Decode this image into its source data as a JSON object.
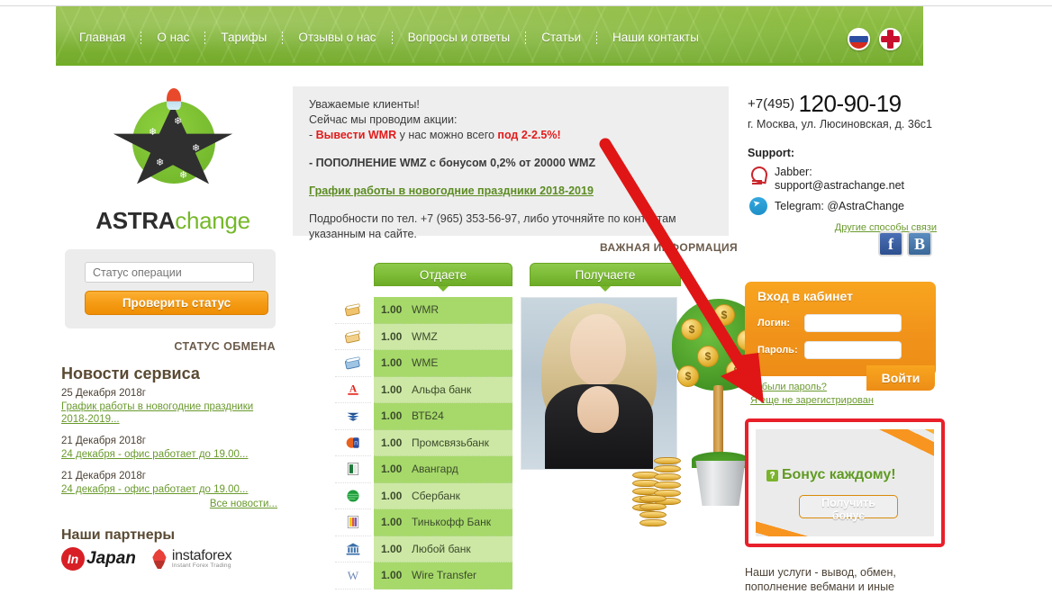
{
  "nav": {
    "items": [
      {
        "label": "Главная"
      },
      {
        "label": "О нас"
      },
      {
        "label": "Тарифы"
      },
      {
        "label": "Отзывы о нас"
      },
      {
        "label": "Вопросы и ответы"
      },
      {
        "label": "Статьи"
      },
      {
        "label": "Наши контакты"
      }
    ],
    "flags": [
      {
        "name": "russian-flag",
        "code": "RU"
      },
      {
        "name": "english-flag",
        "code": "EN"
      }
    ]
  },
  "logo": {
    "text_bold": "ASTRA",
    "text_light": "change"
  },
  "status": {
    "input_placeholder": "Статус операции",
    "input_value": "",
    "button_label": "Проверить статус",
    "caption": "СТАТУС ОБМЕНА"
  },
  "news": {
    "title": "Новости сервиса",
    "items": [
      {
        "date": "25 Декабря 2018г",
        "link": "График работы в новогодние праздники 2018-2019..."
      },
      {
        "date": "21 Декабря 2018г",
        "link": "24 декабря - офис работает до 19.00..."
      },
      {
        "date": "21 Декабря 2018г",
        "link": "24 декабря - офис работает до 19.00..."
      }
    ],
    "all_link": "Все новости..."
  },
  "partners": {
    "title": "Наши партнеры",
    "items": [
      {
        "name": "InJapan",
        "badge": "In",
        "label": "Japan"
      },
      {
        "name": "instaforex",
        "label": "instaforex",
        "sub": "Instant Forex Trading"
      }
    ]
  },
  "announcement": {
    "line1": "Уважаемые клиенты!",
    "line2": "Сейчас мы проводим акции:",
    "line3_prefix": "- ",
    "line3_red1": "Вывести WMR",
    "line3_mid": " у нас можно всего ",
    "line3_red2": "под 2-2.5%",
    "line3_suffix": "!",
    "line4": "- ПОПОЛНЕНИЕ WMZ с бонусом 0,2% от 20000 WMZ",
    "link": "График работы в новогодние праздники 2018-2019",
    "line5": "Подробности по тел. +7 (965) 353-56-97, либо уточняйте по контактам",
    "line6": "указанным на сайте.",
    "important_label": "ВАЖНАЯ ИНФОРМАЦИЯ"
  },
  "contact": {
    "phone_prefix": "+7(495)",
    "phone_main": "120-90-19",
    "address": "г. Москва, ул. Люсиновская, д. 36с1",
    "support_label": "Support:",
    "jabber_label": "Jabber:",
    "jabber_value": "support@astrachange.net",
    "telegram": "Telegram: @AstraChange",
    "other_ways": "Другие способы связи",
    "socials": [
      {
        "name": "facebook",
        "glyph": "f"
      },
      {
        "name": "vkontakte",
        "glyph": "B"
      }
    ]
  },
  "exchange": {
    "tab_give": "Отдаете",
    "tab_get": "Получаете",
    "give_rows": [
      {
        "amount": "1.00",
        "name": "WMR",
        "icon": "wmr-card-icon"
      },
      {
        "amount": "1.00",
        "name": "WMZ",
        "icon": "wmz-card-icon"
      },
      {
        "amount": "1.00",
        "name": "WME",
        "icon": "wme-card-icon"
      },
      {
        "amount": "1.00",
        "name": "Альфа банк",
        "icon": "alfabank-icon"
      },
      {
        "amount": "1.00",
        "name": "ВТБ24",
        "icon": "vtb24-icon"
      },
      {
        "amount": "1.00",
        "name": "Промсвязьбанк",
        "icon": "promsvyazbank-icon"
      },
      {
        "amount": "1.00",
        "name": "Авангард",
        "icon": "avangard-icon"
      },
      {
        "amount": "1.00",
        "name": "Сбербанк",
        "icon": "sberbank-icon"
      },
      {
        "amount": "1.00",
        "name": "Тинькофф Банк",
        "icon": "tinkoff-icon"
      },
      {
        "amount": "1.00",
        "name": "Любой банк",
        "icon": "any-bank-icon"
      },
      {
        "amount": "1.00",
        "name": "Wire Transfer",
        "icon": "wire-transfer-icon"
      }
    ]
  },
  "login": {
    "title": "Вход в кабинет",
    "login_label": "Логин:",
    "login_value": "",
    "password_label": "Пароль:",
    "password_value": "",
    "submit_label": "Войти",
    "forgot_link": "Забыли пароль?",
    "register_link": "Я еще не зарегистрирован"
  },
  "bonus": {
    "title": "Бонус каждому!",
    "badge": "?",
    "button_label": "Получить бонус"
  },
  "services": {
    "line1": "Наши услуги - вывод, обмен,",
    "line2": "пополнение вебмани и иные"
  },
  "colors": {
    "header_green": "#8fc241",
    "row_green_light": "#cde8a5",
    "row_green_dark": "#a6d96a",
    "orange": "#f1931a",
    "link_green": "#6a9a2e",
    "red_alert": "#e21b1b",
    "bonus_border_red": "#e8202a"
  }
}
